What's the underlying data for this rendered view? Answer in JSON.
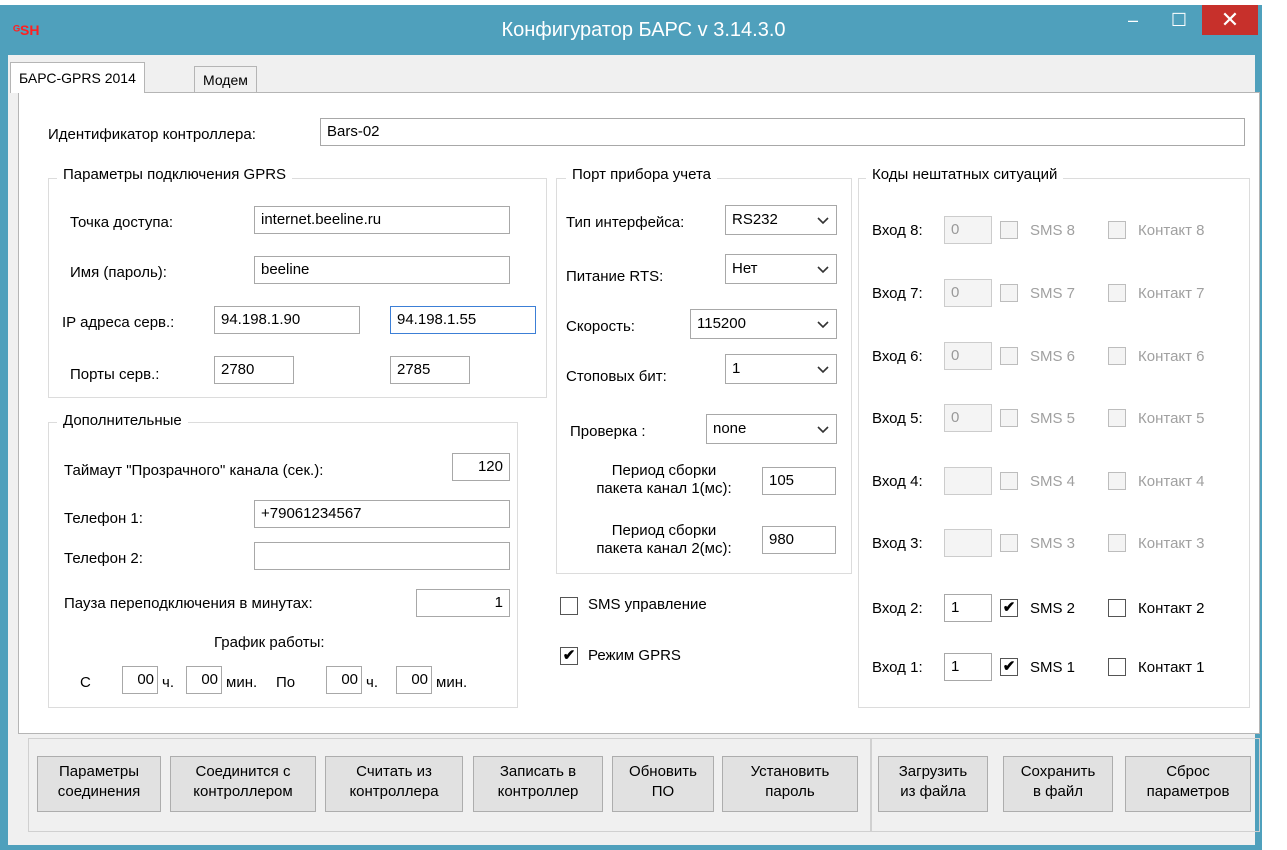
{
  "window": {
    "title": "Конфигуратор БАРС v 3.14.3.0",
    "icon_text": "ᴳSH",
    "minimize": "–",
    "maximize": "☐",
    "close": "✕"
  },
  "tabs": [
    "БАРС-GPRS 2014",
    "Модем"
  ],
  "controller_id": {
    "label": "Идентификатор контроллера:",
    "value": "Bars-02"
  },
  "gprs": {
    "title": "Параметры подключения GPRS",
    "apn_label": "Точка доступа:",
    "apn": "internet.beeline.ru",
    "name_label": "Имя (пароль):",
    "name": "beeline",
    "ip_label": "IP адреса серв.:",
    "ip1": "94.198.1.90",
    "ip2": "94.198.1.55",
    "ports_label": "Порты серв.:",
    "port1": "2780",
    "port2": "2785"
  },
  "extra": {
    "title": "Дополнительные",
    "timeout_label": "Таймаут \"Прозрачного\" канала (сек.):",
    "timeout": "120",
    "phone1_label": "Телефон 1:",
    "phone1": "+79061234567",
    "phone2_label": "Телефон 2:",
    "phone2": "",
    "pause_label": "Пауза переподключения в минутах:",
    "pause": "1",
    "schedule_label": "График работы:",
    "from_label": "С",
    "from_h": "00",
    "h_label": "ч.",
    "from_m": "00",
    "min_label": "мин.",
    "to_label": "По",
    "to_h": "00",
    "to_m": "00"
  },
  "port": {
    "title": "Порт прибора учета",
    "iface_label": "Тип интерфейса:",
    "iface": "RS232",
    "rts_label": "Питание RTS:",
    "rts": "Нет",
    "speed_label": "Скорость:",
    "speed": "115200",
    "stop_label": "Стоповых бит:",
    "stop": "1",
    "check_label": "Проверка :",
    "check": "none",
    "period1_label_1": "Период сборки",
    "period1_label_2": "пакета канал 1(мс):",
    "period1": "105",
    "period2_label_1": "Период сборки",
    "period2_label_2": "пакета канал 2(мс):",
    "period2": "980"
  },
  "sms_control": {
    "label": "SMS управление",
    "checked": false
  },
  "gprs_mode": {
    "label": "Режим GPRS",
    "checked": true
  },
  "emergency": {
    "title": "Коды нештатных ситуаций",
    "rows": [
      {
        "in_label": "Вход 8:",
        "value": "0",
        "sms": "SMS 8",
        "contact": "Контакт 8",
        "enabled": false,
        "sms_checked": false
      },
      {
        "in_label": "Вход 7:",
        "value": "0",
        "sms": "SMS 7",
        "contact": "Контакт 7",
        "enabled": false,
        "sms_checked": false
      },
      {
        "in_label": "Вход 6:",
        "value": "0",
        "sms": "SMS 6",
        "contact": "Контакт 6",
        "enabled": false,
        "sms_checked": false
      },
      {
        "in_label": "Вход 5:",
        "value": "0",
        "sms": "SMS 5",
        "contact": "Контакт 5",
        "enabled": false,
        "sms_checked": false
      },
      {
        "in_label": "Вход 4:",
        "value": "",
        "sms": "SMS 4",
        "contact": "Контакт 4",
        "enabled": false,
        "sms_checked": false
      },
      {
        "in_label": "Вход 3:",
        "value": "",
        "sms": "SMS 3",
        "contact": "Контакт 3",
        "enabled": false,
        "sms_checked": false
      },
      {
        "in_label": "Вход 2:",
        "value": "1",
        "sms": "SMS 2",
        "contact": "Контакт 2",
        "enabled": true,
        "sms_checked": true
      },
      {
        "in_label": "Вход 1:",
        "value": "1",
        "sms": "SMS 1",
        "contact": "Контакт 1",
        "enabled": true,
        "sms_checked": true
      }
    ]
  },
  "buttons": [
    {
      "l1": "Параметры",
      "l2": "соединения"
    },
    {
      "l1": "Соединится с",
      "l2": "контроллером"
    },
    {
      "l1": "Считать из",
      "l2": "контроллера"
    },
    {
      "l1": "Записать в",
      "l2": "контроллер"
    },
    {
      "l1": "Обновить",
      "l2": "ПО"
    },
    {
      "l1": "Установить",
      "l2": "пароль"
    },
    {
      "l1": "Загрузить",
      "l2": "из файла"
    },
    {
      "l1": "Сохранить",
      "l2": "в файл"
    },
    {
      "l1": "Сброс",
      "l2": "параметров"
    }
  ]
}
